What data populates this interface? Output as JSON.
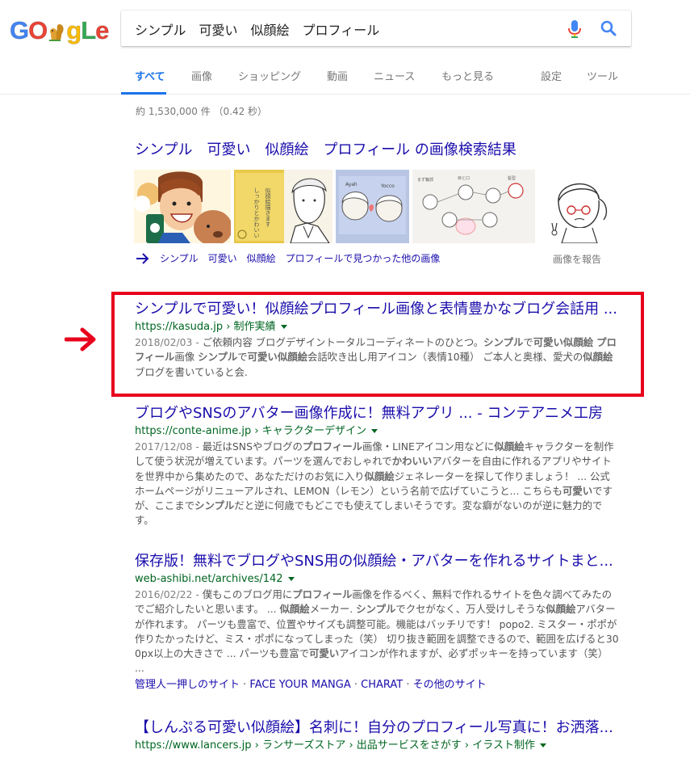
{
  "logo": {
    "letters": [
      "G",
      "O",
      "",
      "g",
      "L",
      "e"
    ]
  },
  "search": {
    "query": "シンプル　可愛い　似顔絵　プロフィール"
  },
  "tabs": [
    {
      "label": "すべて"
    },
    {
      "label": "画像"
    },
    {
      "label": "ショッピング"
    },
    {
      "label": "動画"
    },
    {
      "label": "ニュース"
    },
    {
      "label": "もっと見る"
    },
    {
      "label": "設定"
    },
    {
      "label": "ツール"
    }
  ],
  "stats": "約 1,530,000 件 （0.42 秒）",
  "images": {
    "heading": "シンプル　可愛い　似顔絵　プロフィール の画像検索結果",
    "more": "シンプル　可愛い　似顔絵　プロフィールで見つかった他の画像",
    "report": "画像を報告"
  },
  "results": [
    {
      "title": "シンプルで可愛い！似顔絵プロフィール画像と表情豊かなブログ会話用 ...",
      "url": "https://kasuda.jp › 制作実績",
      "date": "2018/02/03 - ",
      "snippet_parts": [
        {
          "t": "ご依頼内容 ブログデザイントータルコーディネートのひとつ。"
        },
        {
          "t": "シンプル",
          "b": true
        },
        {
          "t": "で"
        },
        {
          "t": "可愛い似顔絵",
          "b": true
        },
        {
          "t": " "
        },
        {
          "t": "プロフィール",
          "b": true
        },
        {
          "t": "画像 "
        },
        {
          "t": "シンプル",
          "b": true
        },
        {
          "t": "で"
        },
        {
          "t": "可愛い似顔絵",
          "b": true
        },
        {
          "t": "会話吹き出し用アイコン（表情10種） ご本人と奥様、愛犬の"
        },
        {
          "t": "似顔絵",
          "b": true
        },
        {
          "t": " ブログを書いていると会."
        }
      ]
    },
    {
      "title": "ブログやSNSのアバター画像作成に！無料アプリ ... - コンテアニメ工房",
      "url": "https://conte-anime.jp › キャラクターデザイン",
      "date": "2017/12/08 - ",
      "snippet_parts": [
        {
          "t": "最近はSNSやブログの"
        },
        {
          "t": "プロフィール",
          "b": true
        },
        {
          "t": "画像・LINEアイコン用などに"
        },
        {
          "t": "似顔絵",
          "b": true
        },
        {
          "t": "キャラクターを制作して使う状況が増えています。パーツを選んでおしゃれで"
        },
        {
          "t": "かわいい",
          "b": true
        },
        {
          "t": "アバターを自由に作れるアプリやサイトを世界中から集めたので、あなただけのお気に入り"
        },
        {
          "t": "似顔絵",
          "b": true
        },
        {
          "t": "ジェネレーターを探して作りましょう！ ... 公式ホームページがリニューアルされ、LEMON（レモン）という名前で広げていこうと... こちらも"
        },
        {
          "t": "可愛い",
          "b": true
        },
        {
          "t": "ですが、ここまで"
        },
        {
          "t": "シンプル",
          "b": true
        },
        {
          "t": "だと逆に何歳でもどこでも使えてしまいそうです。変な癖がないのが逆に魅力的です。"
        }
      ]
    },
    {
      "title": "保存版！無料でブログやSNS用の似顔絵・アバターを作れるサイトまと...",
      "url": "web-ashibi.net/archives/142",
      "date": "2016/02/22 - ",
      "snippet_parts": [
        {
          "t": "僕もこのブログ用に"
        },
        {
          "t": "プロフィール",
          "b": true
        },
        {
          "t": "画像を作るべく、無料で作れるサイトを色々調べてみたのでご紹介したいと思います。 ... "
        },
        {
          "t": "似顔絵",
          "b": true
        },
        {
          "t": "メーカー. "
        },
        {
          "t": "シンプル",
          "b": true
        },
        {
          "t": "でクセがなく、万人受けしそうな"
        },
        {
          "t": "似顔絵",
          "b": true
        },
        {
          "t": "アバターが作れます。 パーツも豊富で、位置やサイズも調整可能。機能はバッチリです！ popo2. ミスター・ポポが作りたかったけど、ミス・ポポになってしまった（笑） 切り抜き範囲を調整できるので、範囲を広げると300px以上の大きさで ... パーツも豊富で"
        },
        {
          "t": "可愛い",
          "b": true
        },
        {
          "t": "アイコンが作れますが、必ずポッキーを持っています（笑） ..."
        }
      ],
      "sitelinks": [
        "管理人一押しのサイト",
        "FACE YOUR MANGA",
        "CHARAT",
        "その他のサイト"
      ]
    },
    {
      "title": "【しんぷる可愛い似顔絵】名刺に！自分のプロフィール写真に！お洒落...",
      "url": "https://www.lancers.jp › ランサーズストア › 出品サービスをさがす › イラスト制作"
    }
  ],
  "colors": {
    "link": "#1a0dab",
    "url": "#006621",
    "highlight": "#e8001c",
    "accent": "#1a73e8"
  }
}
